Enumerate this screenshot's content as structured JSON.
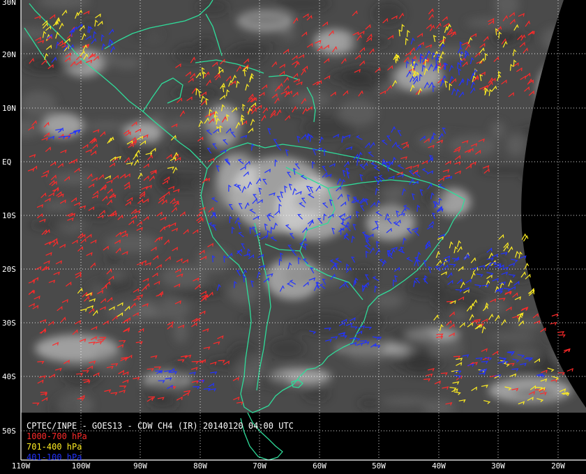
{
  "title": "CPTEC/INPE - GOES13 - CDW CH4 (IR) 20140120 04:00 UTC",
  "legend": [
    {
      "label": "1000-700 hPa",
      "color": "#ff2a2a"
    },
    {
      "label": "701-400 hPa",
      "color": "#ffee22"
    },
    {
      "label": "401-100 hPa",
      "color": "#2233ff"
    }
  ],
  "lat_labels": [
    "30N",
    "20N",
    "10N",
    "EQ",
    "10S",
    "20S",
    "30S",
    "40S",
    "50S"
  ],
  "lon_labels": [
    "110W",
    "100W",
    "90W",
    "80W",
    "70W",
    "60W",
    "50W",
    "40W",
    "30W",
    "20W"
  ],
  "colors": {
    "background": "#000000",
    "coastline": "#2fdc9a",
    "grid": "#ffffff",
    "ir_base": "#4a4a4a",
    "cloud": "#e6e6e6"
  },
  "layers": {
    "imagery": "GOES13 IR satellite imagery",
    "overlay": "wind barbs by pressure level"
  }
}
